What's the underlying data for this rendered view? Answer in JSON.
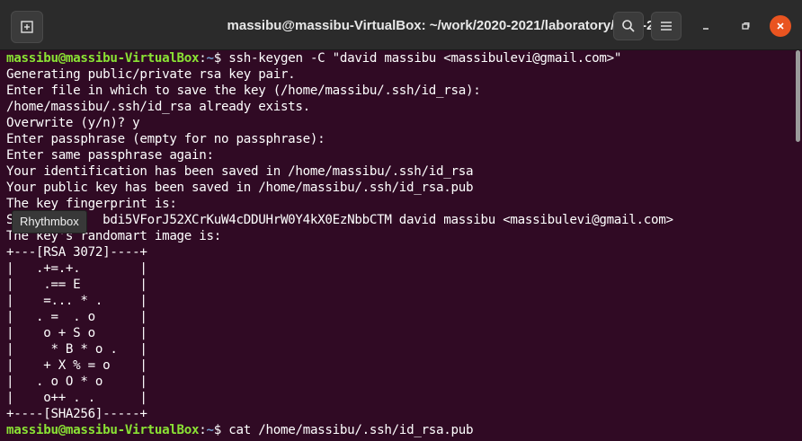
{
  "window": {
    "title": "massibu@massibu-VirtualBox: ~/work/2020-2021/laboratory/LAB-2",
    "icons": {
      "new_tab": "new-tab-icon",
      "search": "search-icon",
      "menu": "hamburger-menu-icon",
      "minimize": "minimize-icon",
      "maximize": "maximize-icon",
      "close": "close-icon"
    },
    "colors": {
      "background": "#300a24",
      "prompt_user": "#8ae234",
      "prompt_path": "#729fcf",
      "close_button": "#e95420"
    }
  },
  "tooltip": {
    "text": "Rhythmbox"
  },
  "terminal": {
    "prompt_user": "massibu@massibu-VirtualBox",
    "prompt_path": "~",
    "command1": "ssh-keygen -C \"david massibu <massibulevi@gmail.com>\"",
    "lines": [
      "Generating public/private rsa key pair.",
      "Enter file in which to save the key (/home/massibu/.ssh/id_rsa):",
      "/home/massibu/.ssh/id_rsa already exists.",
      "Overwrite (y/n)? y",
      "Enter passphrase (empty for no passphrase):",
      "Enter same passphrase again:",
      "Your identification has been saved in /home/massibu/.ssh/id_rsa",
      "Your public key has been saved in /home/massibu/.ssh/id_rsa.pub",
      "The key fingerprint is:",
      "S            bdi5VForJ52XCrKuW4cDDUHrW0Y4kX0EzNbbCTM david massibu <massibulevi@gmail.com>",
      "The key's randomart image is:",
      "+---[RSA 3072]----+",
      "|   .+=.+.        |",
      "|    .== E        |",
      "|    =... * .     |",
      "|   . =  . o      |",
      "|    o + S o      |",
      "|     * B * o .   |",
      "|    + X % = o    |",
      "|   . o O * o     |",
      "|    o++ . .      |",
      "+----[SHA256]-----+"
    ],
    "command2": "cat /home/massibu/.ssh/id_rsa.pub"
  }
}
